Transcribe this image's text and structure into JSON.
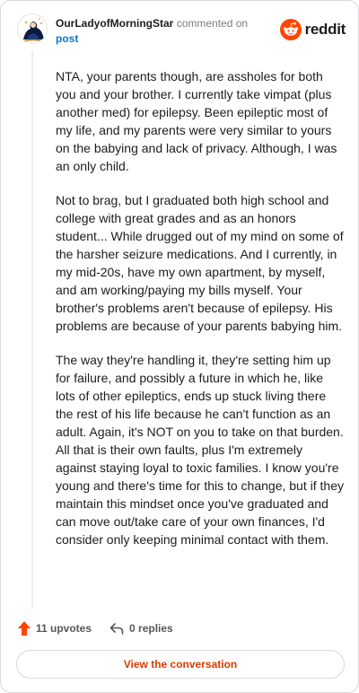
{
  "comment": {
    "username": "OurLadyofMorningStar",
    "action": "commented on",
    "post_link": "post",
    "paragraphs": [
      "NTA, your parents though, are assholes for both you and your brother. I currently take vimpat (plus another med) for epilepsy. Been epileptic most of my life, and my parents were very similar to yours on the babying and lack of privacy. Although, I was an only child.",
      "Not to brag, but I graduated both high school and college with great grades and as an honors student... While drugged out of my mind on some of the harsher seizure medications. And I currently, in my mid-20s, have my own apartment, by myself, and am working/paying my bills myself. Your brother's problems aren't because of epilepsy. His problems are because of your parents babying him.",
      "The way they're handling it, they're setting him up for failure, and possibly a future in which he, like lots of other epileptics, ends up stuck living there the rest of his life because he can't function as an adult. Again, it's NOT on you to take on that burden. All that is their own faults, plus I'm extremely against staying loyal to toxic families. I know you're young and there's time for this to change, but if they maintain this mindset once you've graduated and can move out/take care of your own finances, I'd consider only keeping minimal contact with them."
    ]
  },
  "brand": {
    "wordmark": "reddit",
    "color": "#ff4500"
  },
  "footer": {
    "upvotes": "11 upvotes",
    "replies": "0 replies",
    "upvote_color": "#ff4500"
  },
  "view_button": {
    "label": "View the conversation",
    "color": "#d93a00"
  }
}
